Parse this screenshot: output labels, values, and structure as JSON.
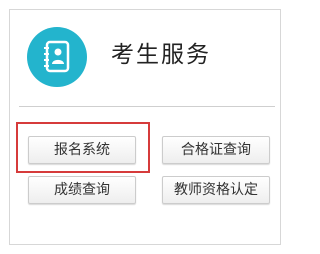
{
  "header": {
    "title": "考生服务",
    "logo_icon": "contact-book-icon"
  },
  "buttons": {
    "register": "报名系统",
    "certificate_query": "合格证查询",
    "score_query": "成绩查询",
    "teacher_certification": "教师资格认定"
  },
  "colors": {
    "accent": "#23b4cd",
    "highlight": "#d63b3b",
    "border": "#d7d7d7"
  }
}
